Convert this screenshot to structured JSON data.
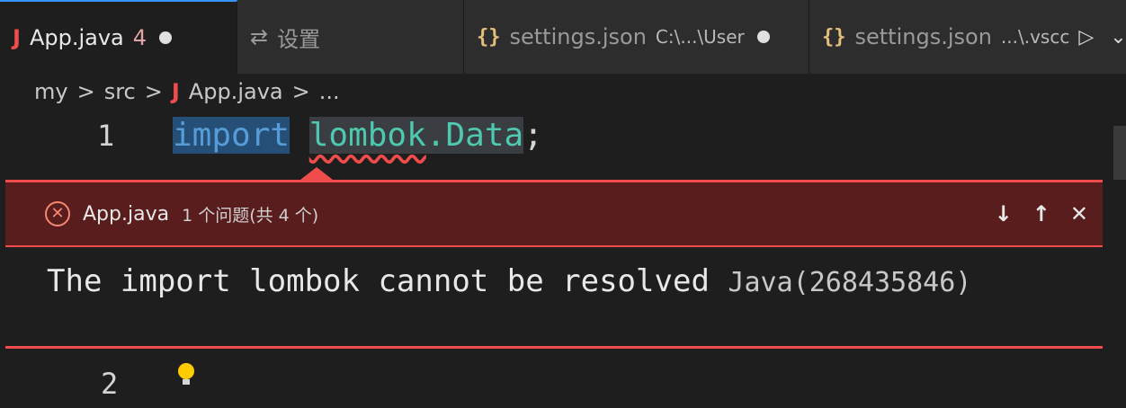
{
  "tabs": [
    {
      "icon": "J",
      "label": "App.java",
      "badge": "4",
      "active": true
    },
    {
      "icon": "⇄",
      "label": "设置",
      "active": false
    },
    {
      "icon": "{}",
      "label": "settings.json",
      "description": "C:\\...\\User",
      "active": false
    },
    {
      "icon": "{}",
      "label": "settings.json",
      "description": "...\\.vscc",
      "active": false
    }
  ],
  "breadcrumb": {
    "items": [
      "my",
      "src",
      "App.java",
      "..."
    ],
    "separator": ">"
  },
  "editor": {
    "line1": {
      "number": "1",
      "keyword": "import",
      "package": "lombok",
      "dot": ".",
      "class": "Data",
      "semicolon": ";"
    },
    "line2": {
      "number": "2"
    }
  },
  "problem_peek": {
    "file": "App.java",
    "count": "1 个问题(共 4 个)",
    "message": "The import lombok cannot be resolved",
    "source": "Java(268435846)",
    "actions": {
      "next": "↓",
      "previous": "↑",
      "close": "✕"
    }
  },
  "colors": {
    "error": "#f14c4c",
    "keyword": "#569cd6",
    "type": "#4ec9b0",
    "peek_header": "#5a1d1d"
  }
}
